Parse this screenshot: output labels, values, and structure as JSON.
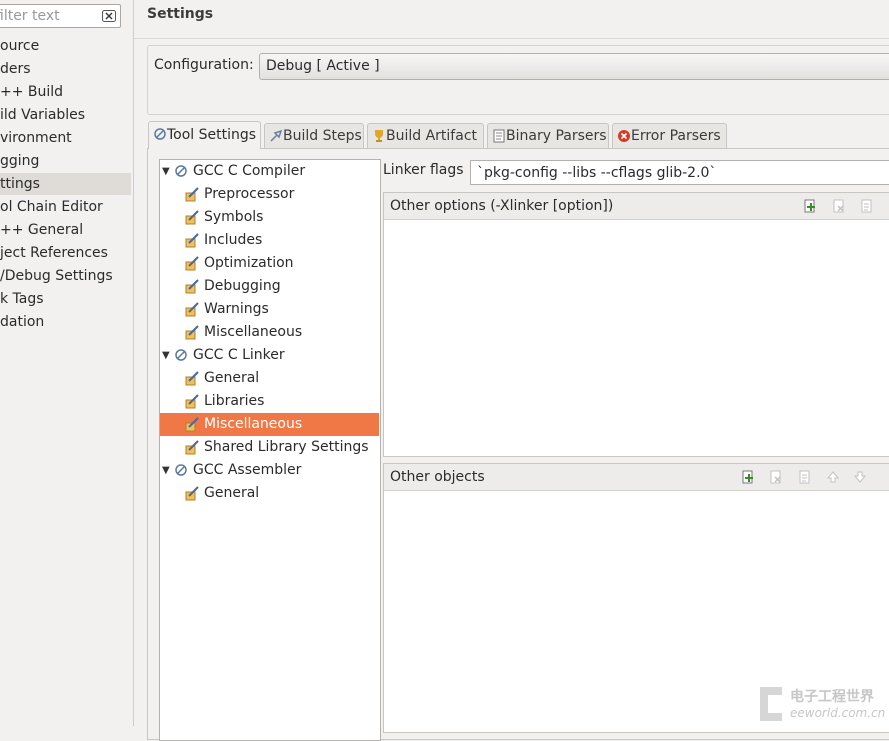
{
  "filter": {
    "placeholder": "filter text"
  },
  "nav": {
    "items": [
      {
        "label": "ource"
      },
      {
        "label": "ders"
      },
      {
        "label": "++ Build"
      },
      {
        "label": "ild Variables"
      },
      {
        "label": "vironment"
      },
      {
        "label": "gging"
      },
      {
        "label": "ttings",
        "selected": true
      },
      {
        "label": "ol Chain Editor"
      },
      {
        "label": "++ General"
      },
      {
        "label": "ject References"
      },
      {
        "label": "/Debug Settings"
      },
      {
        "label": "k Tags"
      },
      {
        "label": "dation"
      }
    ]
  },
  "page_title": "Settings",
  "configuration": {
    "label": "Configuration:",
    "value": "Debug  [ Active ]"
  },
  "tabs": [
    {
      "label": "Tool Settings",
      "icon": "tool-settings-icon",
      "active": true
    },
    {
      "label": "Build Steps",
      "icon": "build-steps-icon"
    },
    {
      "label": "Build Artifact",
      "icon": "build-artifact-icon"
    },
    {
      "label": "Binary Parsers",
      "icon": "binary-parsers-icon"
    },
    {
      "label": "Error Parsers",
      "icon": "error-parsers-icon"
    }
  ],
  "tree": [
    {
      "label": "GCC C Compiler",
      "level": 0,
      "expanded": true
    },
    {
      "label": "Preprocessor",
      "level": 1
    },
    {
      "label": "Symbols",
      "level": 1
    },
    {
      "label": "Includes",
      "level": 1
    },
    {
      "label": "Optimization",
      "level": 1
    },
    {
      "label": "Debugging",
      "level": 1
    },
    {
      "label": "Warnings",
      "level": 1
    },
    {
      "label": "Miscellaneous",
      "level": 1
    },
    {
      "label": "GCC C Linker",
      "level": 0,
      "expanded": true
    },
    {
      "label": "General",
      "level": 1
    },
    {
      "label": "Libraries",
      "level": 1
    },
    {
      "label": "Miscellaneous",
      "level": 1,
      "selected": true
    },
    {
      "label": "Shared Library Settings",
      "level": 1
    },
    {
      "label": "GCC Assembler",
      "level": 0,
      "expanded": true
    },
    {
      "label": "General",
      "level": 1
    }
  ],
  "linker": {
    "label": "Linker flags",
    "value": "`pkg-config --libs --cflags glib-2.0`"
  },
  "other_options": {
    "title": "Other options (-Xlinker [option])",
    "items": []
  },
  "other_objects": {
    "title": "Other objects",
    "items": []
  },
  "colors": {
    "selection": "#f07746",
    "window_bg": "#f2f1f0",
    "add_icon": "#3a8a2a"
  },
  "watermark": {
    "cn": "电子工程世界",
    "en": "eeworld.com.cn"
  }
}
